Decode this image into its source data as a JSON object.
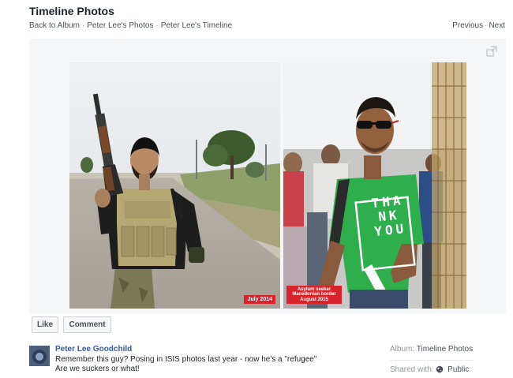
{
  "header": {
    "title": "Timeline Photos",
    "breadcrumbs": [
      "Back to Album",
      "Peter Lee's Photos",
      "Peter Lee's Timeline"
    ],
    "separator": "·",
    "previous": "Previous",
    "next": "Next"
  },
  "photo": {
    "left_tag": "July 2014",
    "right_tag_lines": [
      "Asylum seeker",
      "Macedonian border",
      "August 2015"
    ],
    "shirt_text": [
      "T",
      "H",
      "A",
      "N",
      "K",
      "Y",
      "O",
      "U"
    ],
    "icons": {
      "expand": "expand-icon",
      "audience": "globe-icon"
    }
  },
  "actions": {
    "like": "Like",
    "comment": "Comment"
  },
  "post": {
    "author": "Peter Lee Goodchild",
    "caption_line1": "Remember this guy? Posing in ISIS photos last year - now he's a \"refugee\"",
    "caption_line2": "Are we suckers or what!"
  },
  "meta": {
    "album_label": "Album:",
    "album_value": "Timeline Photos",
    "shared_label": "Shared with:",
    "shared_value": "Public"
  },
  "colors": {
    "link": "#365899",
    "tag_red": "#d8232a",
    "shirt_green": "#2fae4e"
  }
}
